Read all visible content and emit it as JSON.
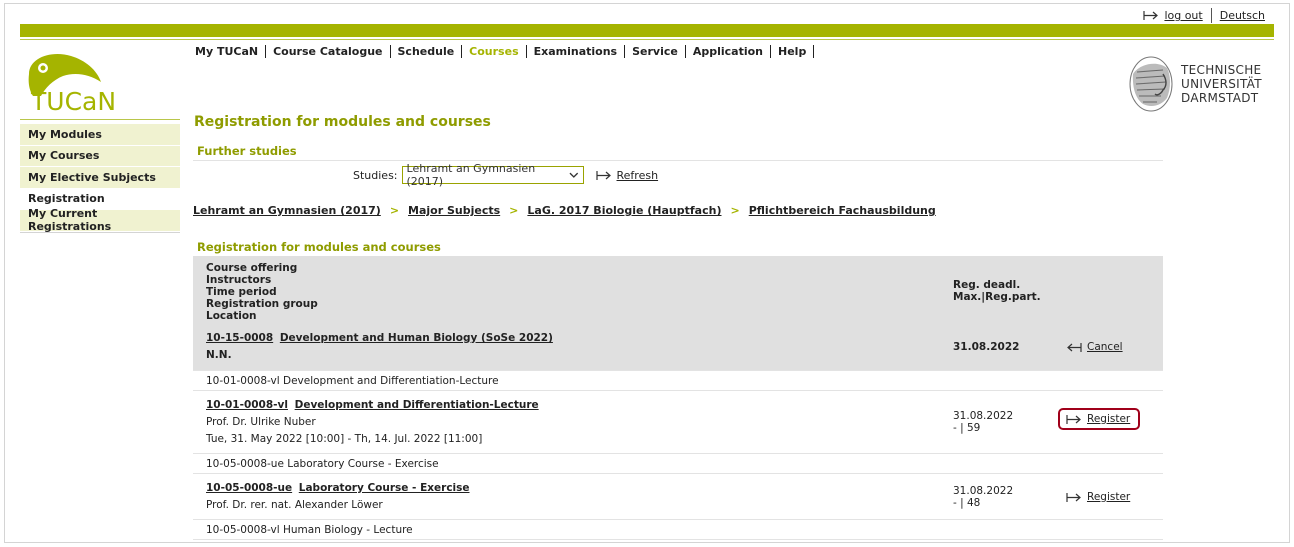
{
  "header": {
    "logout_label": "log out",
    "language_label": "Deutsch",
    "logo_text": "TUCaN",
    "university": [
      "TECHNISCHE",
      "UNIVERSITÄT",
      "DARMSTADT"
    ]
  },
  "mainnav": {
    "items": [
      "My TUCaN",
      "Course Catalogue",
      "Schedule",
      "Courses",
      "Examinations",
      "Service",
      "Application",
      "Help"
    ],
    "active": "Courses"
  },
  "sidebar": {
    "items": [
      "My Modules",
      "My Courses",
      "My Elective Subjects",
      "Registration",
      "My Current Registrations"
    ]
  },
  "page": {
    "title": "Registration for modules and courses",
    "subtitle": "Further studies",
    "studies_label": "Studies:",
    "studies_value": "Lehramt an Gymnasien (2017)",
    "refresh_label": "Refresh",
    "breadcrumb": [
      "Lehramt an Gymnasien (2017)",
      "Major Subjects",
      "LaG. 2017 Biologie (Hauptfach)",
      "Pflichtbereich Fachausbildung"
    ],
    "breadcrumb_sep": ">",
    "section_title": "Registration for modules and courses"
  },
  "table": {
    "header_left": [
      "Course offering",
      "Instructors",
      "Time period",
      "Registration group",
      "Location"
    ],
    "header_right": [
      "Reg. deadl.",
      "Max.|Reg.part."
    ],
    "module": {
      "code": "10-15-0008",
      "title": "Development and Human Biology (SoSe 2022)",
      "instructor": "N.N.",
      "deadline": "31.08.2022",
      "action": "Cancel"
    },
    "rows": [
      {
        "label": "10-01-0008-vl Development and Differentiation-Lecture"
      },
      {
        "code": "10-01-0008-vl",
        "title": "Development and Differentiation-Lecture",
        "instructor": "Prof. Dr. Ulrike Nuber",
        "time": "Tue, 31. May 2022 [10:00] - Th, 14. Jul. 2022 [11:00]",
        "deadline": "31.08.2022",
        "capacity": "- | 59",
        "action": "Register"
      },
      {
        "label": "10-05-0008-ue Laboratory Course - Exercise"
      },
      {
        "code": "10-05-0008-ue",
        "title": "Laboratory Course - Exercise",
        "instructor": "Prof. Dr. rer. nat. Alexander Löwer",
        "deadline": "31.08.2022",
        "capacity": "- | 48",
        "action": "Register"
      },
      {
        "label": "10-05-0008-vl Human Biology - Lecture"
      }
    ]
  },
  "colors": {
    "accent": "#a5b400",
    "heading": "#8f9c00",
    "highlight": "#a0001a",
    "table_header": "#e0e0e0"
  }
}
